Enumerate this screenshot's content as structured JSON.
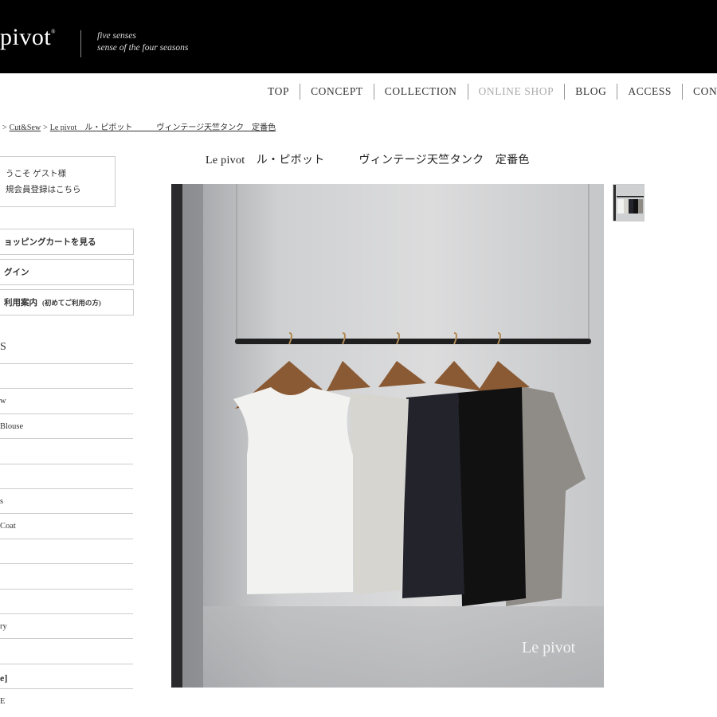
{
  "header": {
    "logo": "pivot",
    "logo_mark": "®",
    "tagline_line1": "five senses",
    "tagline_line2": "sense of the four seasons"
  },
  "nav": [
    {
      "label": "TOP",
      "active": false
    },
    {
      "label": "CONCEPT",
      "active": false
    },
    {
      "label": "COLLECTION",
      "active": false
    },
    {
      "label": "ONLINE SHOP",
      "active": true
    },
    {
      "label": "BLOG",
      "active": false
    },
    {
      "label": "ACCESS",
      "active": false
    },
    {
      "label": "CONT",
      "active": false
    }
  ],
  "breadcrumb": {
    "sep1": ">",
    "item1": "Cut&Sew",
    "sep2": ">",
    "item2": "Le pivot　ル・ピボット　　　ヴィンテージ天竺タンク　定番色"
  },
  "sidebar": {
    "welcome_line1": "うこそ ゲスト様",
    "welcome_line2": "規会員登録はこちら",
    "cart_label": "ョッピングカートを見る",
    "login_label": "グイン",
    "guide_label": "利用案内",
    "guide_note": "(初めてご利用の方)",
    "category_heading": "S",
    "categories": [
      "",
      "w",
      "Blouse",
      "",
      "",
      "s",
      "Coat",
      "",
      "",
      "",
      "ry",
      "",
      "e]",
      "E"
    ]
  },
  "product": {
    "title": "Le pivot　ル・ピボット　　　ヴィンテージ天竺タンク　定番色",
    "watermark": "Le pivot"
  }
}
